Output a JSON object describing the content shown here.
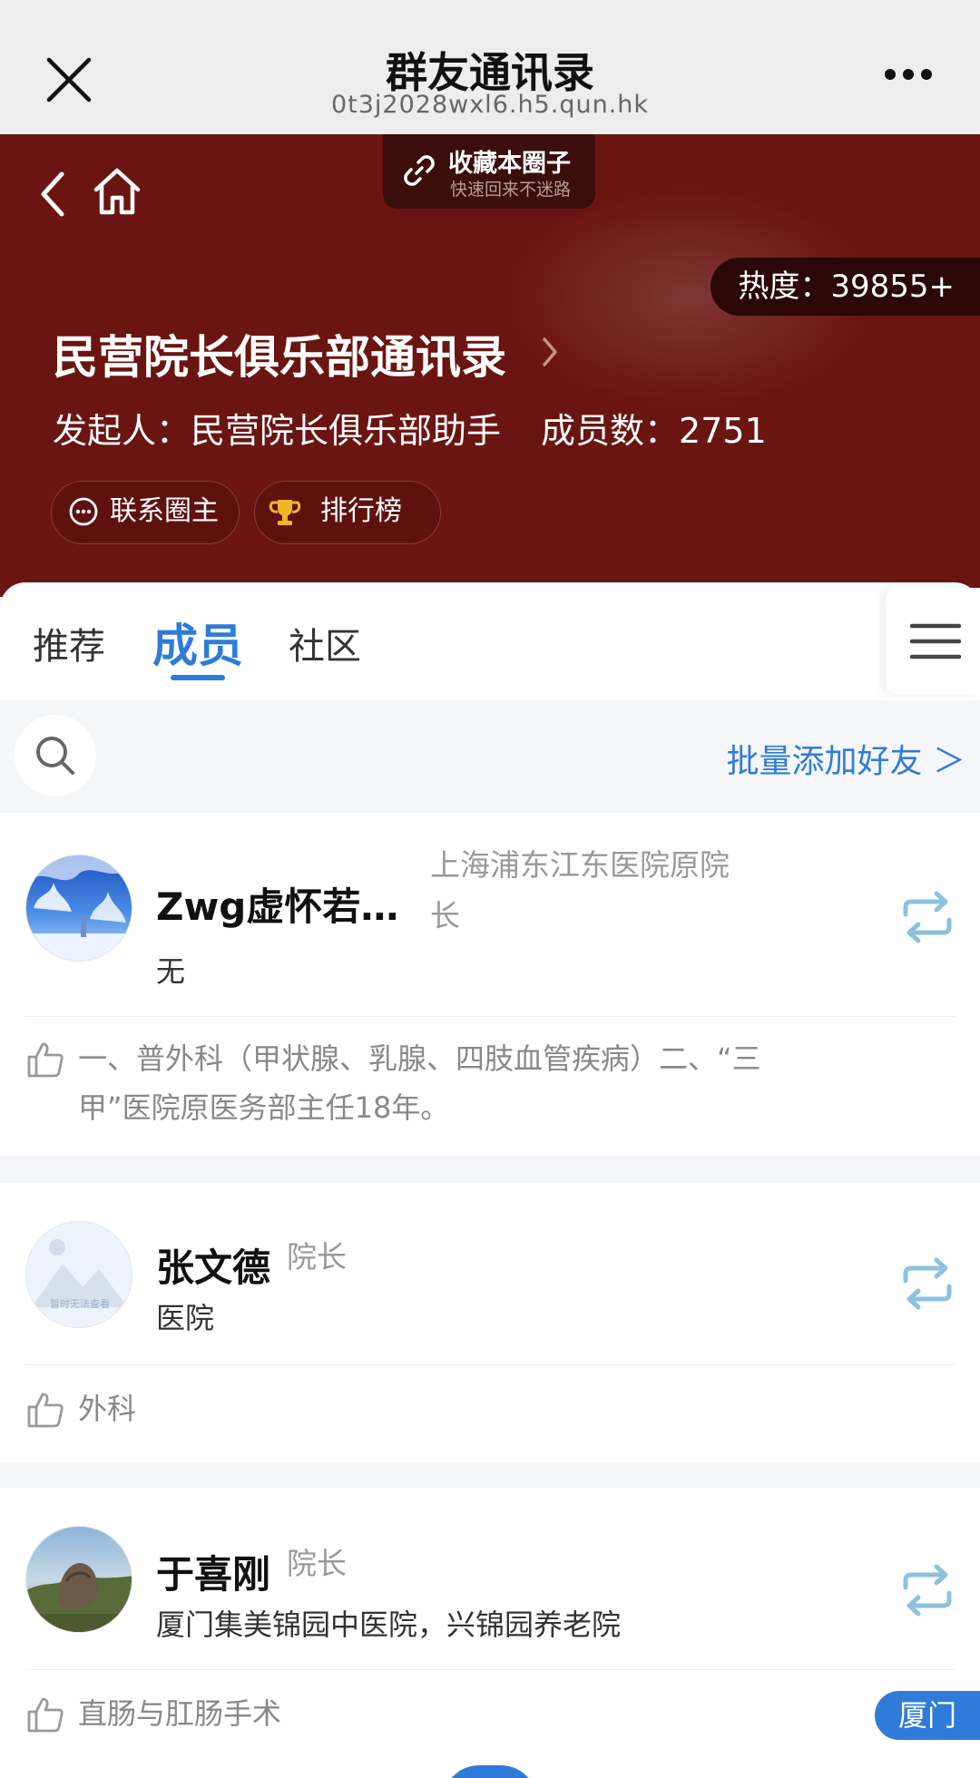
{
  "browser": {
    "title": "群友通讯录",
    "url": "0t3j2028wxl6.h5.qun.hk"
  },
  "hero": {
    "favorite_title": "收藏本圈子",
    "favorite_sub": "快速回来不迷路",
    "heat_label": "热度：",
    "heat_value": "39855+",
    "club_name": "民营院长俱乐部通讯录",
    "founder_label": "发起人：",
    "founder": "民营院长俱乐部助手",
    "members_label": "成员数：",
    "members_count": "2751",
    "contact_button": "联系圈主",
    "ranking_button": "排行榜"
  },
  "tabs": [
    "推荐",
    "成员",
    "社区"
  ],
  "active_tab": "成员",
  "search": {
    "batch_add": "批量添加好友 ＞"
  },
  "members": [
    {
      "name": "Zwg虚怀若…",
      "title_line1": "上海浦东江东医院原院",
      "title_line2": "长",
      "org": "无",
      "specialty_line1": "一、普外科（甲状腺、乳腺、四肢血管疾病）二、“三",
      "specialty_line2": "甲”医院原医务部主任18年。"
    },
    {
      "name": "张文德",
      "title": "院长",
      "org": "医院",
      "avatar_caption": "暂时无法查看",
      "specialty": "外科"
    },
    {
      "name": "于喜刚",
      "title": "院长",
      "org": "厦门集美锦园中医院，兴锦园养老院",
      "specialty": "直肠与肛肠手术",
      "city": "厦门"
    }
  ],
  "colors": {
    "hero_bg": "#6a1512",
    "accent_blue": "#2f7bd9",
    "share_icon": "#8cc2dd"
  }
}
